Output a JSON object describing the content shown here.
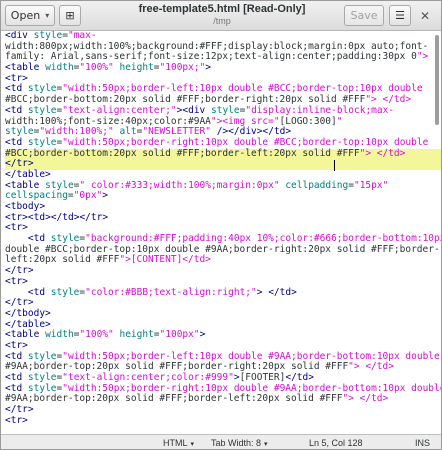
{
  "header": {
    "open_label": "Open",
    "title": "free-template5.html [Read-Only]",
    "subtitle": "/tmp",
    "save_label": "Save",
    "close_glyph": "✕",
    "menu_glyph": "☰",
    "newtab_glyph": "⊞",
    "chevron": "▾"
  },
  "editor": {
    "highlighted_lines": [
      12,
      13
    ],
    "lines": [
      "<div style=\"max-",
      "width:800px;width:100%;background:#FFF;display:block;margin:0px auto;font-",
      "family: Arial,sans-serif;font-size:12px;text-align:center;padding:30px 0\">",
      "<table width=\"100%\" height=\"100px;\">",
      "<tr>",
      "<td style=\"width:50px;border-left:10px double #BCC;border-top:10px double",
      "#BCC;border-bottom:20px solid #FFF;border-right:20px solid #FFF\"> </td>",
      "<td style=\"text-align:center;\"><div style=\"display:inline-block;max-",
      "width:100%;font-size:40px;color:#9AA\"><img src=\"[LOGO:300]\"",
      "style=\"width:100%;\" alt=\"NEWSLETTER\" /></div></td>",
      "<td style=\"width:50px;border-right:10px double #BCC;border-top:10px double",
      "#BCC;border-bottom:20px solid #FFF;border-left:20px solid #FFF\"> </td>",
      "</tr>",
      "</table>",
      "<table style=\" color:#333;width:100%;margin:0px\" cellpadding=\"15px\"",
      "cellspacing=\"0px\">",
      "<tbody>",
      "<tr><td></td></tr>",
      "<tr>",
      "    <td style=\"background:#FFF;padding:40px 10%;color:#666;border-bottom:10px",
      "double #BCC;border-top:10px double #9AA;border-right:20px solid #FFF;border-",
      "left:20px solid #FFF\">[CONTENT]</td>",
      "</tr>",
      "<tr>",
      "    <td style=\"color:#BBB;text-align:right;\"> </td>",
      "</tr>",
      "</tbody>",
      "</table>",
      "<table width=\"100%\" height=\"100px\">",
      "<tr>",
      "<td style=\"width:50px;border-left:10px double #9AA;border-bottom:10px double",
      "#9AA;border-top:20px solid #FFF;border-right:20px solid #FFF\"> </td>",
      "<td style=\"text-align:center;color:#999\">[FOOTER]</td>",
      "<td style=\"width:50px;border-right:10px double #9AA;border-bottom:10px double",
      "#9AA;border-top:20px solid #FFF;border-left:20px solid #FFF\"> </td>",
      "</tr>",
      "<tr>"
    ]
  },
  "statusbar": {
    "language": "HTML",
    "tab_width": "Tab Width: 8",
    "position": "Ln 5, Col 128",
    "mode": "INS"
  },
  "colors": {
    "highlight": "#f4f69a",
    "tag": "#000080",
    "attribute": "#008080",
    "string": "#d10fd1"
  }
}
